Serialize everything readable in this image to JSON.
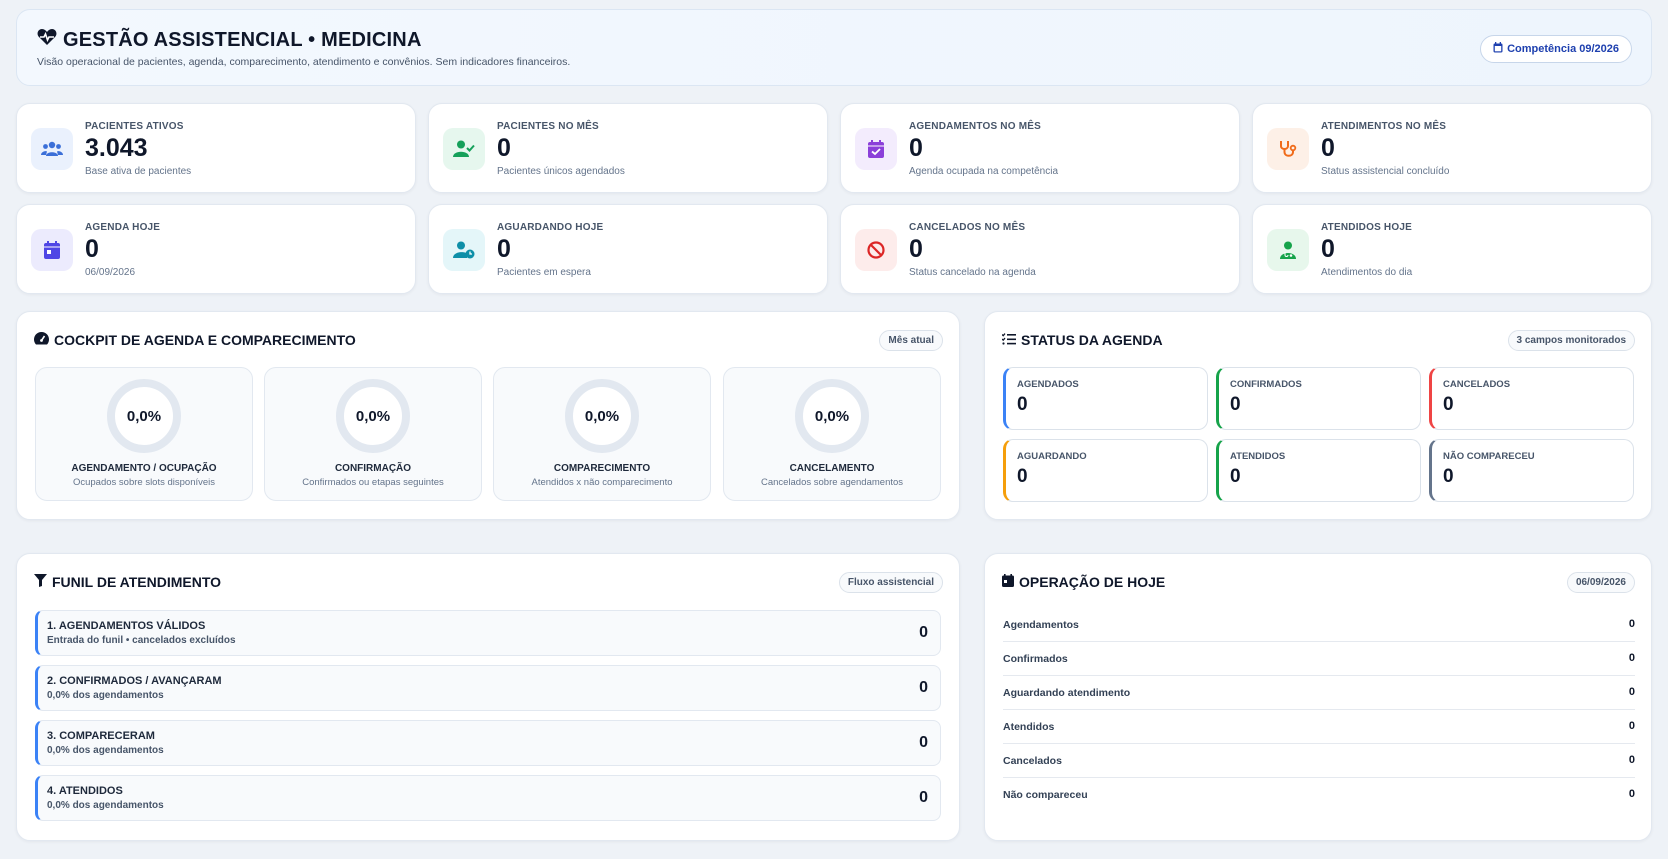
{
  "header": {
    "title": "GESTÃO ASSISTENCIAL • MEDICINA",
    "subtitle": "Visão operacional de pacientes, agenda, comparecimento, atendimento e convênios. Sem indicadores financeiros.",
    "competencia": "Competência 09/2026"
  },
  "kpis": [
    {
      "label": "PACIENTES ATIVOS",
      "value": "3.043",
      "sub": "Base ativa de pacientes",
      "icon": "users-icon",
      "color": "#3b6fd8",
      "bg": "#eaf1fd"
    },
    {
      "label": "PACIENTES NO MÊS",
      "value": "0",
      "sub": "Pacientes únicos agendados",
      "icon": "user-check-icon",
      "color": "#15a05a",
      "bg": "#e6f7ee"
    },
    {
      "label": "AGENDAMENTOS NO MÊS",
      "value": "0",
      "sub": "Agenda ocupada na competência",
      "icon": "calendar-check-icon",
      "color": "#8b3fd9",
      "bg": "#f3ecfd"
    },
    {
      "label": "ATENDIMENTOS NO MÊS",
      "value": "0",
      "sub": "Status assistencial concluído",
      "icon": "stethoscope-icon",
      "color": "#f06b1a",
      "bg": "#fdf0e7"
    },
    {
      "label": "AGENDA HOJE",
      "value": "0",
      "sub": "06/09/2026",
      "icon": "calendar-icon",
      "color": "#4f46e5",
      "bg": "#ecebfd"
    },
    {
      "label": "AGUARDANDO HOJE",
      "value": "0",
      "sub": "Pacientes em espera",
      "icon": "user-clock-icon",
      "color": "#0e8fa8",
      "bg": "#e4f6f9"
    },
    {
      "label": "CANCELADOS NO MÊS",
      "value": "0",
      "sub": "Status cancelado na agenda",
      "icon": "ban-icon",
      "color": "#dc2626",
      "bg": "#fdeceb"
    },
    {
      "label": "ATENDIDOS HOJE",
      "value": "0",
      "sub": "Atendimentos do dia",
      "icon": "user-doctor-icon",
      "color": "#16a34a",
      "bg": "#e7f7ec"
    }
  ],
  "cockpit": {
    "title": "COCKPIT DE AGENDA E COMPARECIMENTO",
    "badge": "Mês atual",
    "gauges": [
      {
        "value": "0,0%",
        "label": "AGENDAMENTO / OCUPAÇÃO",
        "sub": "Ocupados sobre slots disponíveis"
      },
      {
        "value": "0,0%",
        "label": "CONFIRMAÇÃO",
        "sub": "Confirmados ou etapas seguintes"
      },
      {
        "value": "0,0%",
        "label": "COMPARECIMENTO",
        "sub": "Atendidos x não comparecimento"
      },
      {
        "value": "0,0%",
        "label": "CANCELAMENTO",
        "sub": "Cancelados sobre agendamentos"
      }
    ]
  },
  "status": {
    "title": "STATUS DA AGENDA",
    "badge": "3 campos monitorados",
    "tiles": [
      {
        "label": "AGENDADOS",
        "value": "0",
        "color": "#3b82f6"
      },
      {
        "label": "CONFIRMADOS",
        "value": "0",
        "color": "#16a34a"
      },
      {
        "label": "CANCELADOS",
        "value": "0",
        "color": "#ef4444"
      },
      {
        "label": "AGUARDANDO",
        "value": "0",
        "color": "#f59e0b"
      },
      {
        "label": "ATENDIDOS",
        "value": "0",
        "color": "#16a34a"
      },
      {
        "label": "NÃO COMPARECEU",
        "value": "0",
        "color": "#64748b"
      }
    ]
  },
  "funnel": {
    "title": "FUNIL DE ATENDIMENTO",
    "badge": "Fluxo assistencial",
    "rows": [
      {
        "title": "1. AGENDAMENTOS VÁLIDOS",
        "sub": "Entrada do funil • cancelados excluídos",
        "value": "0"
      },
      {
        "title": "2. CONFIRMADOS / AVANÇARAM",
        "sub": "0,0% dos agendamentos",
        "value": "0"
      },
      {
        "title": "3. COMPARECERAM",
        "sub": "0,0% dos agendamentos",
        "value": "0"
      },
      {
        "title": "4. ATENDIDOS",
        "sub": "0,0% dos agendamentos",
        "value": "0"
      }
    ]
  },
  "today": {
    "title": "OPERAÇÃO DE HOJE",
    "badge": "06/09/2026",
    "rows": [
      {
        "label": "Agendamentos",
        "value": "0"
      },
      {
        "label": "Confirmados",
        "value": "0"
      },
      {
        "label": "Aguardando atendimento",
        "value": "0"
      },
      {
        "label": "Atendidos",
        "value": "0"
      },
      {
        "label": "Cancelados",
        "value": "0"
      },
      {
        "label": "Não compareceu",
        "value": "0"
      }
    ]
  }
}
